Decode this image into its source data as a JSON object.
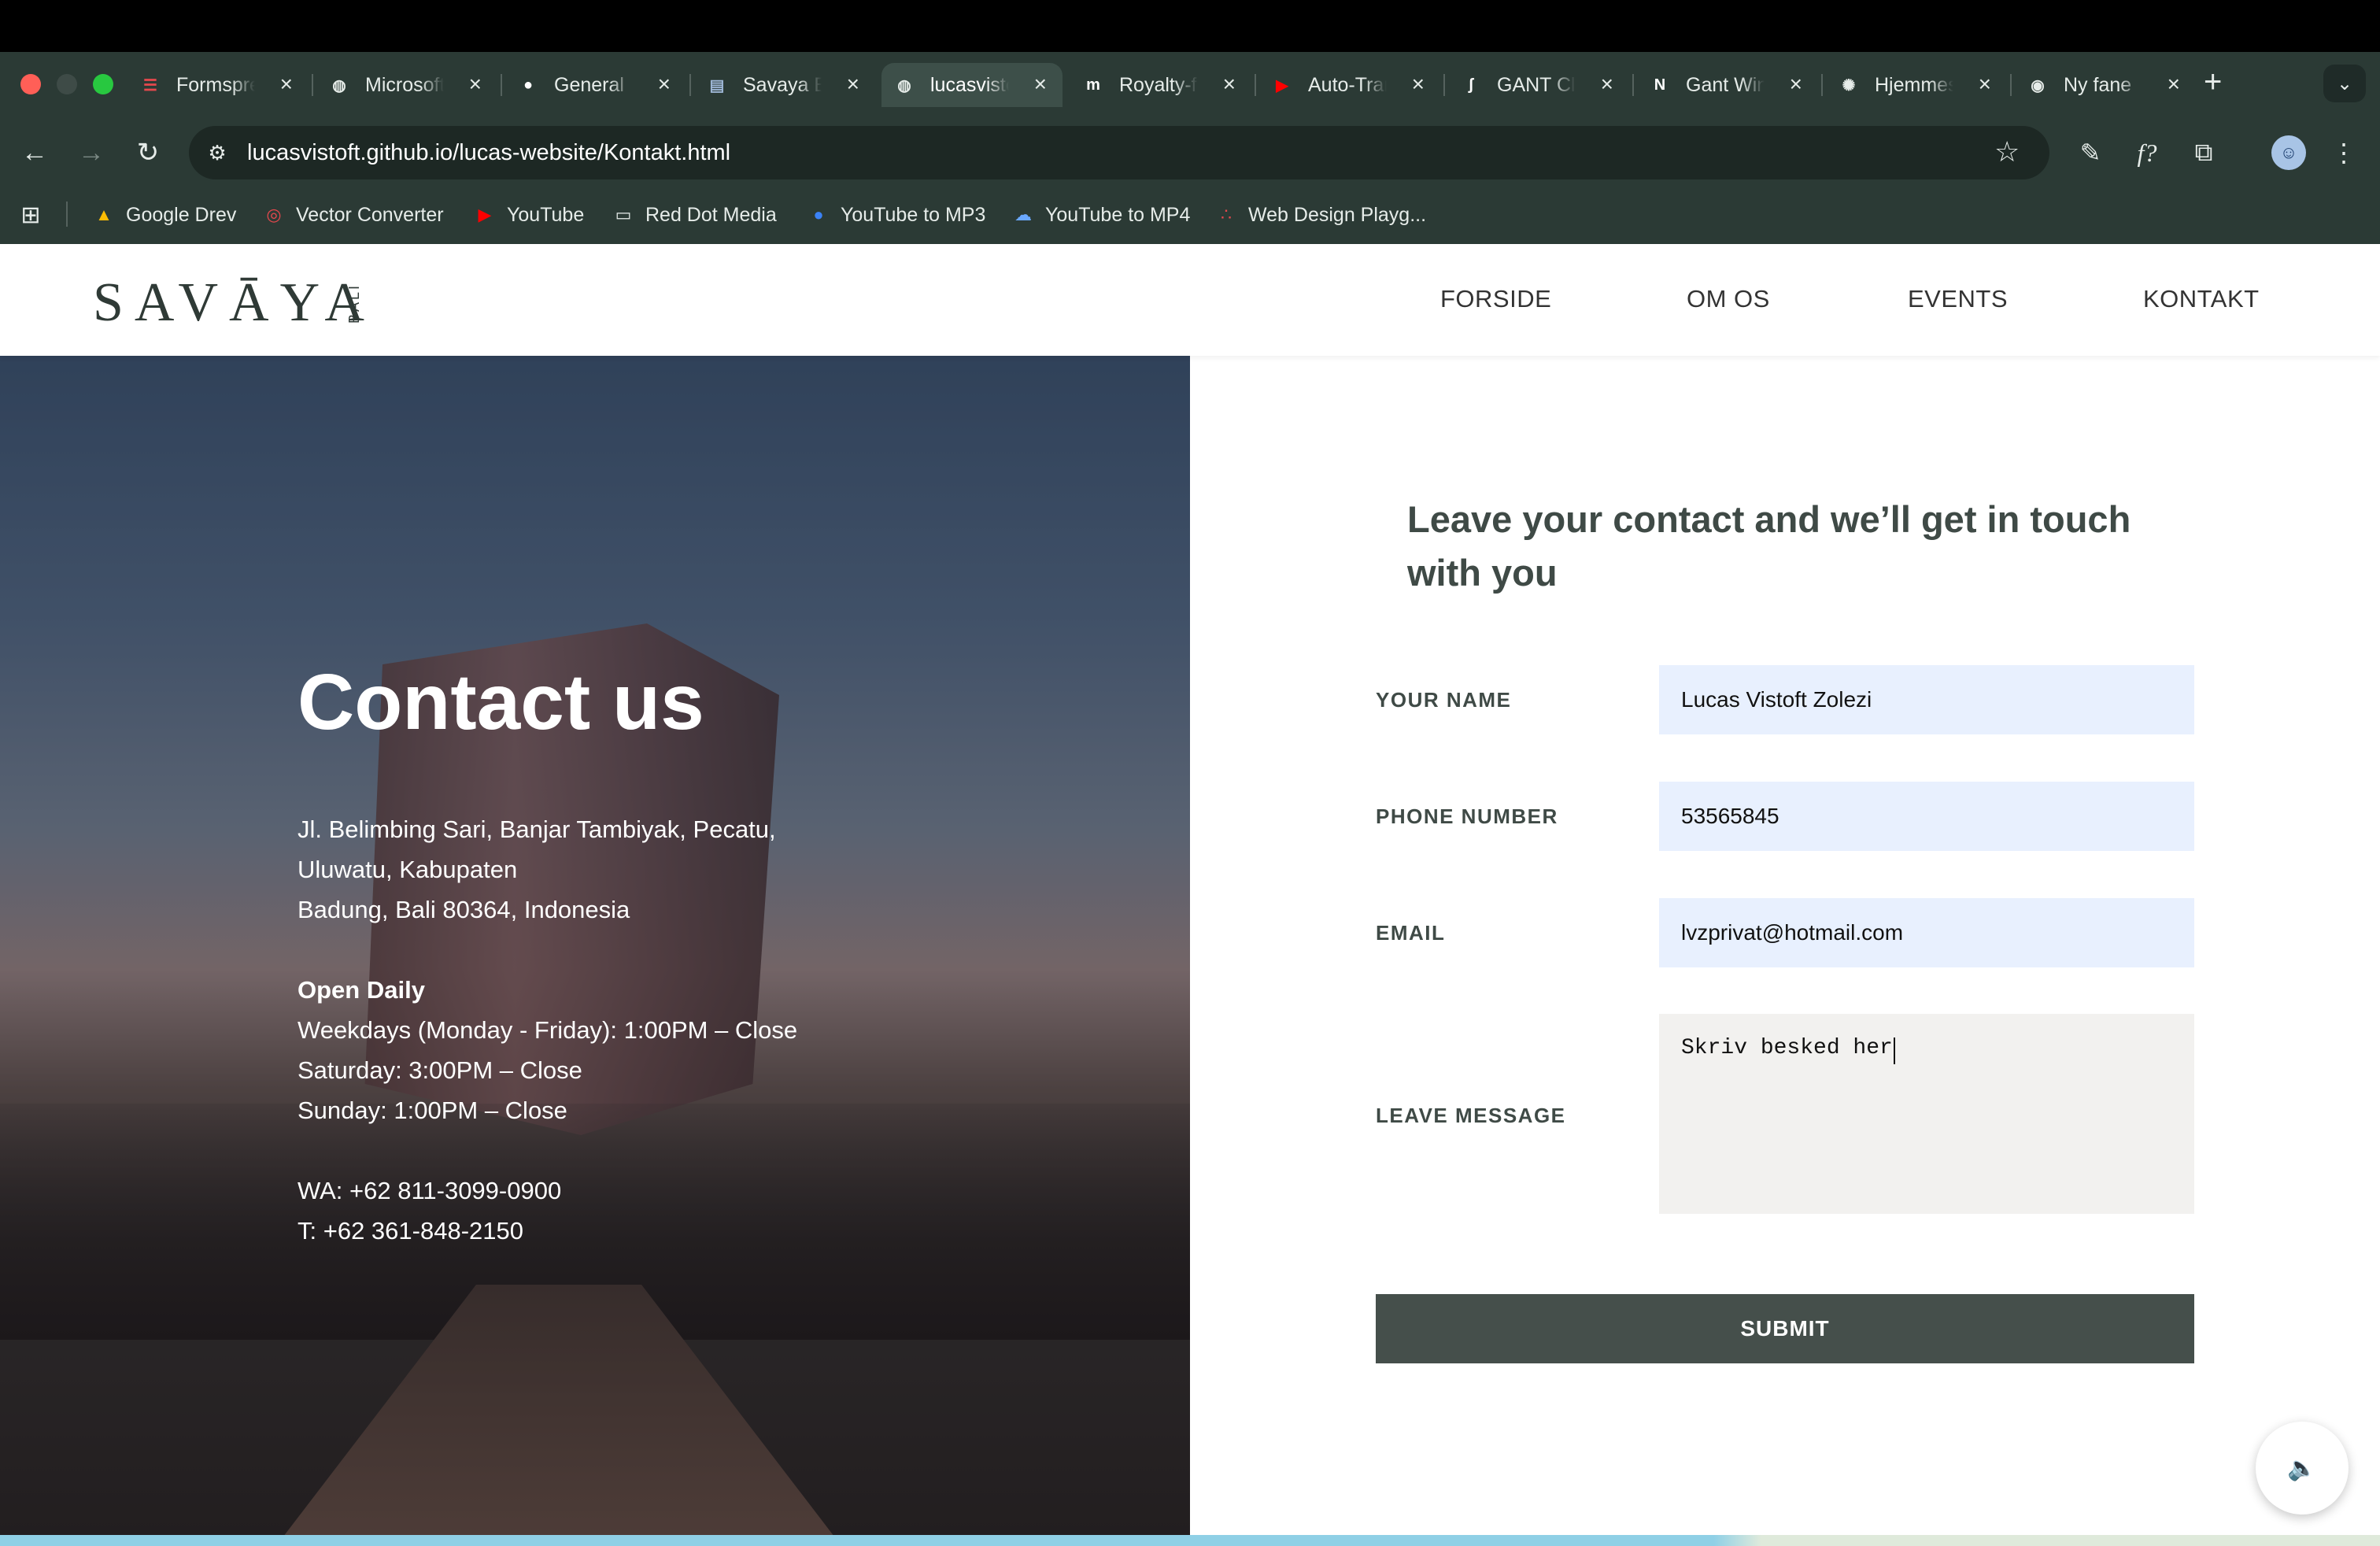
{
  "browser": {
    "tabs": [
      {
        "title": "Formspree",
        "favicon": "formspree-icon",
        "favicon_glyph": "☰",
        "favicon_color": "#e5484d",
        "active": false
      },
      {
        "title": "Microsoft",
        "favicon": "globe-icon",
        "favicon_glyph": "◍",
        "favicon_color": "#e6ece9",
        "active": false
      },
      {
        "title": "General",
        "favicon": "github-icon",
        "favicon_glyph": "●",
        "favicon_color": "#ffffff",
        "active": false
      },
      {
        "title": "Savaya Bali",
        "favicon": "document-icon",
        "favicon_glyph": "▤",
        "favicon_color": "#9fb8d8",
        "active": false
      },
      {
        "title": "lucasvistoft",
        "favicon": "globe-icon",
        "favicon_glyph": "◍",
        "favicon_color": "#e6ece9",
        "active": true
      },
      {
        "title": "Royalty-free",
        "favicon": "royalty-icon",
        "favicon_glyph": "m",
        "favicon_color": "#ffffff",
        "active": false
      },
      {
        "title": "Auto-Translate",
        "favicon": "youtube-icon",
        "favicon_glyph": "▶",
        "favicon_color": "#ff0000",
        "active": false
      },
      {
        "title": "GANT Clothing",
        "favicon": "gant-icon",
        "favicon_glyph": "ʃ",
        "favicon_color": "#ffffff",
        "active": false
      },
      {
        "title": "Gant Winter",
        "favicon": "inn-icon",
        "favicon_glyph": "N",
        "favicon_color": "#ffffff",
        "active": false
      },
      {
        "title": "Hjemmeside",
        "favicon": "openai-icon",
        "favicon_glyph": "✺",
        "favicon_color": "#e6ece9",
        "active": false
      },
      {
        "title": "Ny fane",
        "favicon": "chrome-icon",
        "favicon_glyph": "◉",
        "favicon_color": "#e6ece9",
        "active": false
      }
    ],
    "url": "lucasvistoft.github.io/lucas-website/Kontakt.html",
    "bookmarks": [
      {
        "label": "Google Drev",
        "icon": "google-drive-icon",
        "glyph": "▲",
        "color": "#fbbc04"
      },
      {
        "label": "Vector Converter",
        "icon": "vector-converter-icon",
        "glyph": "◎",
        "color": "#e5484d"
      },
      {
        "label": "YouTube",
        "icon": "youtube-icon",
        "glyph": "▶",
        "color": "#ff0000"
      },
      {
        "label": "Red Dot Media",
        "icon": "folder-icon",
        "glyph": "▭",
        "color": "#e6ece9"
      },
      {
        "label": "YouTube to MP3",
        "icon": "mp3-icon",
        "glyph": "●",
        "color": "#3b82f6"
      },
      {
        "label": "YouTube to MP4",
        "icon": "cloud-download-icon",
        "glyph": "☁",
        "color": "#6aa8ff"
      },
      {
        "label": "Web Design Playg...",
        "icon": "web-design-icon",
        "glyph": "∴",
        "color": "#e5484d"
      }
    ]
  },
  "site": {
    "logo": "SAVĀYA",
    "logo_sub": "BALI",
    "nav": [
      "FORSIDE",
      "OM OS",
      "EVENTS",
      "KONTAKT"
    ]
  },
  "hero": {
    "title": "Contact us",
    "address": [
      "Jl. Belimbing Sari, Banjar Tambiyak, Pecatu,",
      "Uluwatu, Kabupaten",
      "Badung, Bali 80364, Indonesia"
    ],
    "hours_title": "Open Daily",
    "hours": [
      "Weekdays (Monday - Friday): 1:00PM – Close",
      "Saturday: 3:00PM – Close",
      "Sunday: 1:00PM – Close"
    ],
    "phones": [
      "WA: +62 811-3099-0900",
      "T: +62 361-848-2150"
    ]
  },
  "form": {
    "title": "Leave your contact and we’ll get in touch with you",
    "name_label": "YOUR NAME",
    "name_value": "Lucas Vistoft Zolezi",
    "phone_label": "PHONE NUMBER",
    "phone_value": "53565845",
    "email_label": "EMAIL",
    "email_value": "lvzprivat@hotmail.com",
    "message_label": "LEAVE MESSAGE",
    "message_value": "Skriv besked her",
    "submit_label": "SUBMIT"
  }
}
